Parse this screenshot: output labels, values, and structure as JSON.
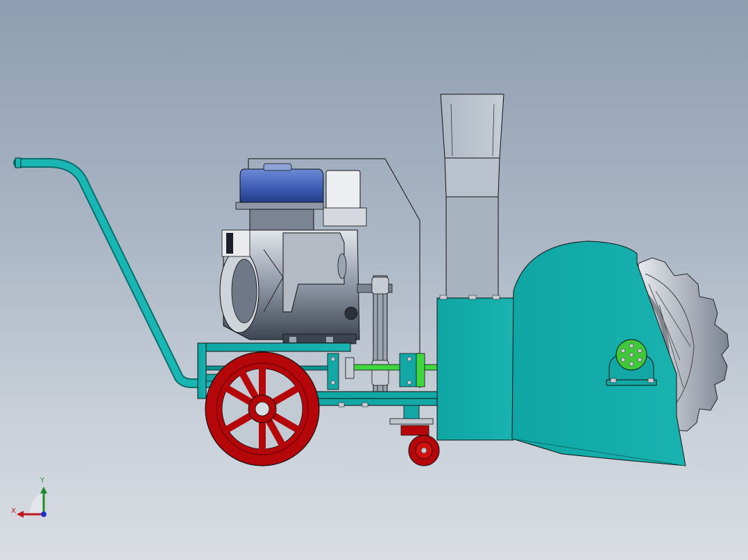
{
  "viewport": {
    "background_top": "#8e9db1",
    "background_bottom": "#d9dde3"
  },
  "colors": {
    "frame_teal": "#13a8a6",
    "frame_teal_dark": "#0b7d7b",
    "wheel_red": "#b5060a",
    "wheel_red_dark": "#7a0406",
    "engine_tank_blue": "#3c5fb8",
    "engine_grey": "#9aa3b0",
    "engine_dark": "#3d4450",
    "shaft_green": "#3fd640",
    "bearing_green": "#3ec83a",
    "outline": "#0a0a0a"
  },
  "triad": {
    "x_label": "X",
    "y_label": "Y",
    "x_color": "#c0161d",
    "y_color": "#1e8a2c",
    "z_color": "#1d2fd0"
  }
}
